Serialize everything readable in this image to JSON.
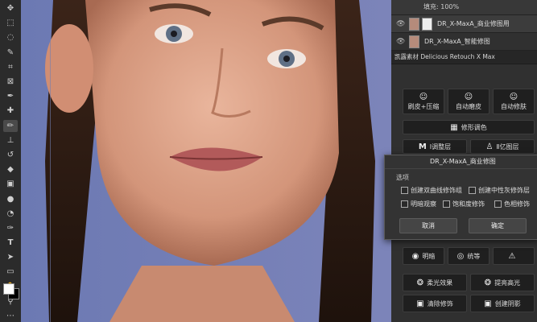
{
  "toolbar": {
    "tools": [
      "move-icon",
      "marquee-icon",
      "lasso-icon",
      "quick-select-icon",
      "crop-icon",
      "frame-icon",
      "eyedropper-icon",
      "healing-icon",
      "brush-icon",
      "stamp-icon",
      "history-brush-icon",
      "eraser-icon",
      "gradient-icon",
      "blur-icon",
      "dodge-icon",
      "pen-icon",
      "type-icon",
      "path-select-icon",
      "shape-icon",
      "hand-icon",
      "zoom-icon",
      "more-icon"
    ],
    "active_tool": "brush-icon",
    "foreground_color": "#ffffff",
    "background_color": "#000000"
  },
  "layers": {
    "fill_label": "填充: 100%",
    "items": [
      {
        "name": "DR_X-MaxA_商业修图用"
      },
      {
        "name": "DR_X-MaxA_智能修图"
      }
    ]
  },
  "plugin": {
    "title": "凯露素材 Delicious Retouch X Max",
    "buttons": [
      {
        "label": "刷皮+压缩",
        "icon": "face-icon"
      },
      {
        "label": "自动磨皮",
        "icon": "face-icon"
      },
      {
        "label": "自动修肤",
        "icon": "face-icon"
      },
      {
        "label": "修形调色",
        "icon": "grid-icon"
      },
      {
        "label": "Ⅰ调整层",
        "icon": "m-icon"
      },
      {
        "label": "Ⅱ亿图层",
        "icon": "person-icon"
      },
      {
        "label": "明暗",
        "icon": "eye-icon"
      },
      {
        "label": "统等",
        "icon": "circle-icon"
      },
      {
        "label": "",
        "icon": "warning-icon"
      },
      {
        "label": "柔光效果",
        "icon": "swirl-icon"
      },
      {
        "label": "提亮高光",
        "icon": "swirl-icon"
      },
      {
        "label": "清除修饰",
        "icon": "image-icon"
      },
      {
        "label": "创建阴影",
        "icon": "image-icon"
      }
    ]
  },
  "dialog": {
    "title": "DR_X-MaxA_商业修图",
    "group_label": "选项",
    "checkboxes": [
      {
        "label": "创建双曲线修饰组",
        "checked": false
      },
      {
        "label": "创建中性灰修饰层",
        "checked": false
      },
      {
        "label": "明暗观察",
        "checked": false
      },
      {
        "label": "饱和度修饰",
        "checked": false
      },
      {
        "label": "色相修饰",
        "checked": false
      }
    ],
    "cancel_label": "取消",
    "ok_label": "确定"
  }
}
